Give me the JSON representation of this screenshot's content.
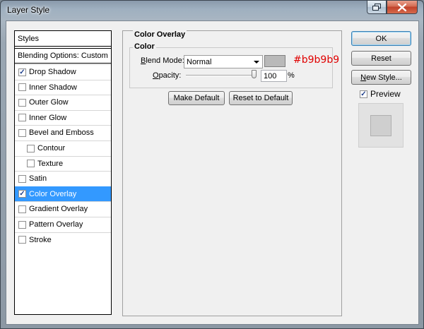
{
  "window": {
    "title": "Layer Style"
  },
  "styles": {
    "header": "Styles",
    "blending_options": "Blending Options: Custom",
    "items": [
      {
        "label": "Drop Shadow",
        "checked": true
      },
      {
        "label": "Inner Shadow",
        "checked": false
      },
      {
        "label": "Outer Glow",
        "checked": false
      },
      {
        "label": "Inner Glow",
        "checked": false
      },
      {
        "label": "Bevel and Emboss",
        "checked": false
      },
      {
        "label": "Contour",
        "checked": false,
        "indent": true
      },
      {
        "label": "Texture",
        "checked": false,
        "indent": true
      },
      {
        "label": "Satin",
        "checked": false
      },
      {
        "label": "Color Overlay",
        "checked": true,
        "active": true
      },
      {
        "label": "Gradient Overlay",
        "checked": false
      },
      {
        "label": "Pattern Overlay",
        "checked": false
      },
      {
        "label": "Stroke",
        "checked": false
      }
    ]
  },
  "color_overlay": {
    "group_title": "Color Overlay",
    "subgroup_title": "Color",
    "blend_mode_label_prefix": "Blend Mode:",
    "blend_mode_value": "Normal",
    "swatch_color": "#b9b9b9",
    "swatch_hex_label": "#b9b9b9",
    "hex_label_color": "#e00000",
    "opacity_label": "Opacity:",
    "opacity_value": "100",
    "opacity_unit": "%",
    "make_default": "Make Default",
    "reset_to_default": "Reset to Default"
  },
  "actions": {
    "ok": "OK",
    "reset": "Reset",
    "new_style": "New Style...",
    "preview_label": "Preview",
    "preview_checked": true
  },
  "preview": {
    "background": "#e2e2e2",
    "fill": "#cfcfcf"
  }
}
